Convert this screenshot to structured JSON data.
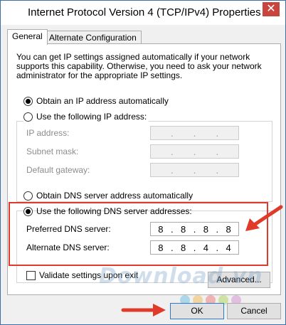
{
  "window": {
    "title": "Internet Protocol Version 4 (TCP/IPv4) Properties",
    "close_glyph": "✕"
  },
  "tabs": [
    {
      "label": "General",
      "active": true
    },
    {
      "label": "Alternate Configuration",
      "active": false
    }
  ],
  "general": {
    "description": "You can get IP settings assigned automatically if your network supports this capability. Otherwise, you need to ask your network administrator for the appropriate IP settings.",
    "ip_auto_label": "Obtain an IP address automatically",
    "ip_manual_label": "Use the following IP address:",
    "ip_address_label": "IP address:",
    "subnet_label": "Subnet mask:",
    "gateway_label": "Default gateway:",
    "ip_dots": ".",
    "dns_auto_label": "Obtain DNS server address automatically",
    "dns_manual_label": "Use the following DNS server addresses:",
    "preferred_label": "Preferred DNS server:",
    "alternate_label": "Alternate DNS server:",
    "preferred_dns": [
      "8",
      "8",
      "8",
      "8"
    ],
    "alternate_dns": [
      "8",
      "8",
      "4",
      "4"
    ],
    "validate_label": "Validate settings upon exit",
    "advanced_label": "Advanced..."
  },
  "footer": {
    "ok_label": "OK",
    "cancel_label": "Cancel"
  },
  "watermark": {
    "text": "Download.vn"
  },
  "colors": {
    "highlight": "#e03a2a",
    "close_button": "#c7453c",
    "default_button_border": "#2a7ad6"
  }
}
